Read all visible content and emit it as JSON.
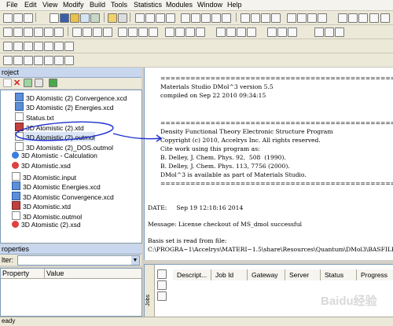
{
  "menu": [
    "File",
    "Edit",
    "View",
    "Modify",
    "Build",
    "Tools",
    "Statistics",
    "Modules",
    "Window",
    "Help"
  ],
  "project": {
    "header": "roject",
    "items": [
      {
        "label": "3D Atomistic (2) Convergence.xcd",
        "icon": "chart-icon"
      },
      {
        "label": "3D Atomistic (2) Energies.xcd",
        "icon": "chart-icon"
      },
      {
        "label": "Status.txt",
        "icon": "text-file-icon"
      },
      {
        "label": "3D Atomistic (2).xtd",
        "icon": "trajectory-icon"
      },
      {
        "label": "3D Atomistic (2).outmol",
        "icon": "text-file-icon"
      },
      {
        "label": "3D Atomistic (2)_DOS.outmol",
        "icon": "text-file-icon"
      },
      {
        "label": "3D Atomistic - Calculation",
        "icon": "calculation-icon"
      },
      {
        "label": "3D Atomistic.xsd",
        "icon": "structure-icon"
      },
      {
        "label": "3D Atomistic.input",
        "icon": "text-file-icon"
      },
      {
        "label": "3D Atomistic Energies.xcd",
        "icon": "chart-icon"
      },
      {
        "label": "3D Atomistic Convergence.xcd",
        "icon": "chart-icon"
      },
      {
        "label": "3D Atomistic.xtd",
        "icon": "trajectory-icon"
      },
      {
        "label": "3D Atomistic.outmol",
        "icon": "text-file-icon"
      },
      {
        "label": "3D Atomistic (2).xsd",
        "icon": "structure-icon"
      }
    ]
  },
  "properties": {
    "header": "roperties",
    "filter_label": "lter:",
    "columns": [
      "Property",
      "Value"
    ]
  },
  "document": {
    "lines": [
      "=================================================================",
      "Materials Studio DMol^3 version 5.5",
      "compiled on Sep 22 2010 09:34:15",
      "",
      "=================================================================",
      "Density Functional Theory Electronic Structure Program",
      "Copyright (c) 2010, Accelrys Inc. All rights reserved.",
      "Cite work using this program as:",
      "B. Delley, J. Chem. Phys. 92,  508  (1990).",
      "B. Delley, J. Chem. Phys. 113, 7756 (2000).",
      "DMol^3 is available as part of Materials Studio.",
      "================================================================="
    ],
    "date_line": "DATE:     Sep 19 12:18:16 2014",
    "message_line": "Message: License checkout of MS_dmol successful",
    "basis_line1": "Basis set is read from file:",
    "basis_line2": "C:\\PROGRA~1\\Accelrys\\MATERI~1.5\\share\\Resources\\Quantum\\DMol3\\BASFILE_v3"
  },
  "jobs": {
    "side_label": "Jobs",
    "columns": [
      "Descript...",
      "Job Id",
      "Gateway",
      "Server",
      "Status",
      "Progress"
    ]
  },
  "statusbar": {
    "text": "eady"
  },
  "watermark": "Baidu经验",
  "colors": {
    "annotation": "#1e2fd0",
    "tree_selected": "#d9e4f7",
    "panel_header": "#c9d7ee"
  }
}
